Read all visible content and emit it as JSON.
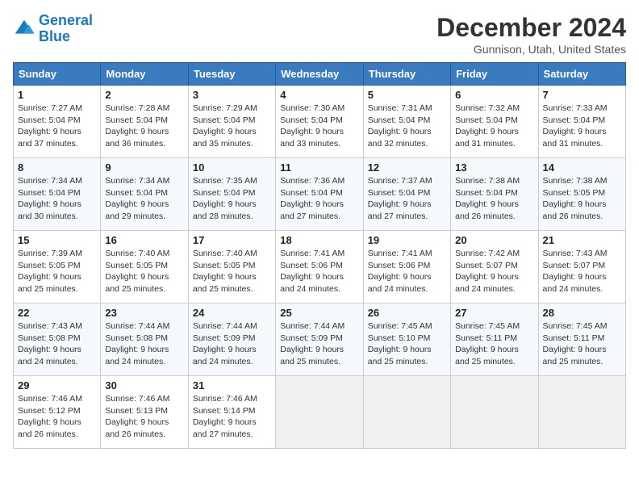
{
  "logo": {
    "line1": "General",
    "line2": "Blue"
  },
  "title": {
    "month_year": "December 2024",
    "location": "Gunnison, Utah, United States"
  },
  "headers": [
    "Sunday",
    "Monday",
    "Tuesday",
    "Wednesday",
    "Thursday",
    "Friday",
    "Saturday"
  ],
  "weeks": [
    [
      {
        "day": "1",
        "sunrise": "Sunrise: 7:27 AM",
        "sunset": "Sunset: 5:04 PM",
        "daylight": "Daylight: 9 hours and 37 minutes."
      },
      {
        "day": "2",
        "sunrise": "Sunrise: 7:28 AM",
        "sunset": "Sunset: 5:04 PM",
        "daylight": "Daylight: 9 hours and 36 minutes."
      },
      {
        "day": "3",
        "sunrise": "Sunrise: 7:29 AM",
        "sunset": "Sunset: 5:04 PM",
        "daylight": "Daylight: 9 hours and 35 minutes."
      },
      {
        "day": "4",
        "sunrise": "Sunrise: 7:30 AM",
        "sunset": "Sunset: 5:04 PM",
        "daylight": "Daylight: 9 hours and 33 minutes."
      },
      {
        "day": "5",
        "sunrise": "Sunrise: 7:31 AM",
        "sunset": "Sunset: 5:04 PM",
        "daylight": "Daylight: 9 hours and 32 minutes."
      },
      {
        "day": "6",
        "sunrise": "Sunrise: 7:32 AM",
        "sunset": "Sunset: 5:04 PM",
        "daylight": "Daylight: 9 hours and 31 minutes."
      },
      {
        "day": "7",
        "sunrise": "Sunrise: 7:33 AM",
        "sunset": "Sunset: 5:04 PM",
        "daylight": "Daylight: 9 hours and 31 minutes."
      }
    ],
    [
      {
        "day": "8",
        "sunrise": "Sunrise: 7:34 AM",
        "sunset": "Sunset: 5:04 PM",
        "daylight": "Daylight: 9 hours and 30 minutes."
      },
      {
        "day": "9",
        "sunrise": "Sunrise: 7:34 AM",
        "sunset": "Sunset: 5:04 PM",
        "daylight": "Daylight: 9 hours and 29 minutes."
      },
      {
        "day": "10",
        "sunrise": "Sunrise: 7:35 AM",
        "sunset": "Sunset: 5:04 PM",
        "daylight": "Daylight: 9 hours and 28 minutes."
      },
      {
        "day": "11",
        "sunrise": "Sunrise: 7:36 AM",
        "sunset": "Sunset: 5:04 PM",
        "daylight": "Daylight: 9 hours and 27 minutes."
      },
      {
        "day": "12",
        "sunrise": "Sunrise: 7:37 AM",
        "sunset": "Sunset: 5:04 PM",
        "daylight": "Daylight: 9 hours and 27 minutes."
      },
      {
        "day": "13",
        "sunrise": "Sunrise: 7:38 AM",
        "sunset": "Sunset: 5:04 PM",
        "daylight": "Daylight: 9 hours and 26 minutes."
      },
      {
        "day": "14",
        "sunrise": "Sunrise: 7:38 AM",
        "sunset": "Sunset: 5:05 PM",
        "daylight": "Daylight: 9 hours and 26 minutes."
      }
    ],
    [
      {
        "day": "15",
        "sunrise": "Sunrise: 7:39 AM",
        "sunset": "Sunset: 5:05 PM",
        "daylight": "Daylight: 9 hours and 25 minutes."
      },
      {
        "day": "16",
        "sunrise": "Sunrise: 7:40 AM",
        "sunset": "Sunset: 5:05 PM",
        "daylight": "Daylight: 9 hours and 25 minutes."
      },
      {
        "day": "17",
        "sunrise": "Sunrise: 7:40 AM",
        "sunset": "Sunset: 5:05 PM",
        "daylight": "Daylight: 9 hours and 25 minutes."
      },
      {
        "day": "18",
        "sunrise": "Sunrise: 7:41 AM",
        "sunset": "Sunset: 5:06 PM",
        "daylight": "Daylight: 9 hours and 24 minutes."
      },
      {
        "day": "19",
        "sunrise": "Sunrise: 7:41 AM",
        "sunset": "Sunset: 5:06 PM",
        "daylight": "Daylight: 9 hours and 24 minutes."
      },
      {
        "day": "20",
        "sunrise": "Sunrise: 7:42 AM",
        "sunset": "Sunset: 5:07 PM",
        "daylight": "Daylight: 9 hours and 24 minutes."
      },
      {
        "day": "21",
        "sunrise": "Sunrise: 7:43 AM",
        "sunset": "Sunset: 5:07 PM",
        "daylight": "Daylight: 9 hours and 24 minutes."
      }
    ],
    [
      {
        "day": "22",
        "sunrise": "Sunrise: 7:43 AM",
        "sunset": "Sunset: 5:08 PM",
        "daylight": "Daylight: 9 hours and 24 minutes."
      },
      {
        "day": "23",
        "sunrise": "Sunrise: 7:44 AM",
        "sunset": "Sunset: 5:08 PM",
        "daylight": "Daylight: 9 hours and 24 minutes."
      },
      {
        "day": "24",
        "sunrise": "Sunrise: 7:44 AM",
        "sunset": "Sunset: 5:09 PM",
        "daylight": "Daylight: 9 hours and 24 minutes."
      },
      {
        "day": "25",
        "sunrise": "Sunrise: 7:44 AM",
        "sunset": "Sunset: 5:09 PM",
        "daylight": "Daylight: 9 hours and 25 minutes."
      },
      {
        "day": "26",
        "sunrise": "Sunrise: 7:45 AM",
        "sunset": "Sunset: 5:10 PM",
        "daylight": "Daylight: 9 hours and 25 minutes."
      },
      {
        "day": "27",
        "sunrise": "Sunrise: 7:45 AM",
        "sunset": "Sunset: 5:11 PM",
        "daylight": "Daylight: 9 hours and 25 minutes."
      },
      {
        "day": "28",
        "sunrise": "Sunrise: 7:45 AM",
        "sunset": "Sunset: 5:11 PM",
        "daylight": "Daylight: 9 hours and 25 minutes."
      }
    ],
    [
      {
        "day": "29",
        "sunrise": "Sunrise: 7:46 AM",
        "sunset": "Sunset: 5:12 PM",
        "daylight": "Daylight: 9 hours and 26 minutes."
      },
      {
        "day": "30",
        "sunrise": "Sunrise: 7:46 AM",
        "sunset": "Sunset: 5:13 PM",
        "daylight": "Daylight: 9 hours and 26 minutes."
      },
      {
        "day": "31",
        "sunrise": "Sunrise: 7:46 AM",
        "sunset": "Sunset: 5:14 PM",
        "daylight": "Daylight: 9 hours and 27 minutes."
      },
      null,
      null,
      null,
      null
    ]
  ]
}
